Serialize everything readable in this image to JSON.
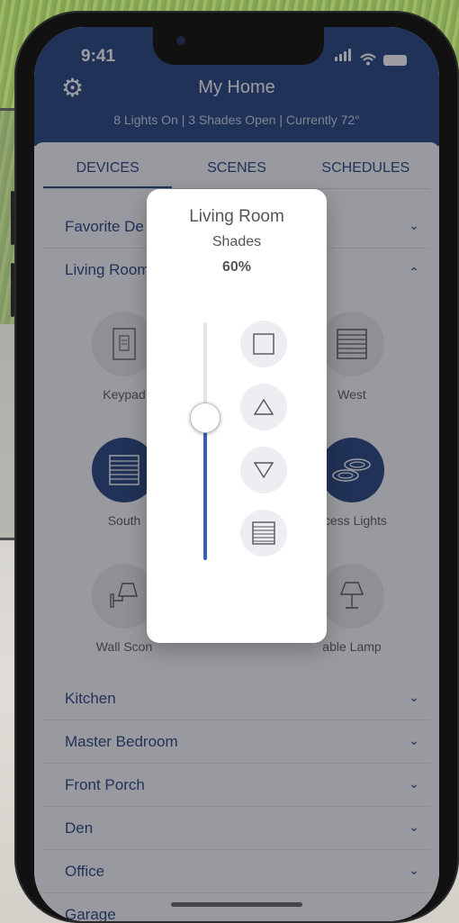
{
  "status_bar": {
    "time": "9:41"
  },
  "header": {
    "title": "My Home",
    "summary": "8 Lights On  |  3 Shades Open  |  Currently 72°"
  },
  "tabs": [
    {
      "label": "DEVICES",
      "active": true
    },
    {
      "label": "SCENES",
      "active": false
    },
    {
      "label": "SCHEDULES",
      "active": false
    }
  ],
  "sections": {
    "favorite": "Favorite De",
    "living_room": "Living Room",
    "kitchen": "Kitchen",
    "master_bedroom": "Master Bedroom",
    "front_porch": "Front Porch",
    "den": "Den",
    "office": "Office",
    "garage": "Garage"
  },
  "devices": {
    "keypad": "Keypad",
    "west": "West",
    "south": "South",
    "recess_lights": "ecess Lights",
    "wall_sconce": "Wall Scon",
    "table_lamp": "able Lamp"
  },
  "modal": {
    "room": "Living Room",
    "device_type": "Shades",
    "level_text": "60%",
    "level": 0.6
  },
  "colors": {
    "brand_blue": "#1f3c7a",
    "slider_fill": "#3a5fb0"
  },
  "icons": {
    "settings": "gear-icon",
    "stop": "stop-square-icon",
    "open": "triangle-up-icon",
    "close": "triangle-down-icon",
    "preset": "shade-preset-icon"
  }
}
